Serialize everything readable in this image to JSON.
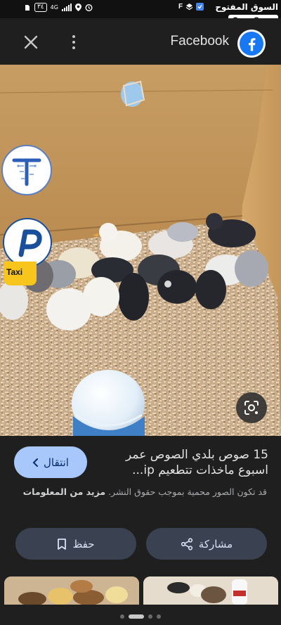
{
  "status_bar": {
    "battery": "٣٤",
    "network": "4G",
    "brand_arabic": "السوق المفتوح",
    "brand_english": "OpenSooq"
  },
  "header": {
    "source_name": "Facebook",
    "icons": [
      "close-icon",
      "more-vert-icon",
      "facebook-logo-icon"
    ]
  },
  "image": {
    "subject": "chicks in cardboard box",
    "icons": [
      "google-lens-icon"
    ],
    "overlay_ads": [
      "t-logo",
      "p-logo",
      "Taxi"
    ]
  },
  "overlay": {
    "taxi_label": "Taxi"
  },
  "result": {
    "title": "15 صوص بلدي الصوص عمر اسبوع ماخذات تتطعيم ip...",
    "visit_label": "انتقال",
    "copyright_note": "قد تكون الصور محمية بموجب حقوق النشر.",
    "more_info_label": "مزيد من المعلومات",
    "save_label": "حفظ",
    "share_label": "مشاركة"
  },
  "colors": {
    "background": "#1f1f1f",
    "visit_button": "#a8c7fa",
    "action_button": "#3a4150",
    "facebook_blue": "#1877f2"
  }
}
